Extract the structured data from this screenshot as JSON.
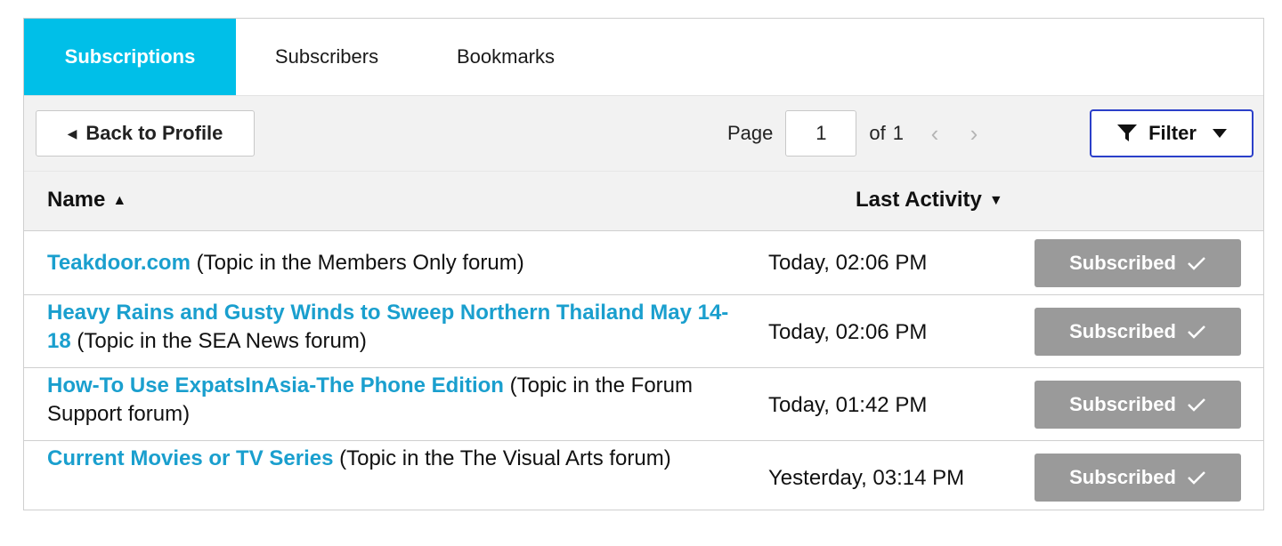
{
  "tabs": [
    {
      "label": "Subscriptions",
      "active": true
    },
    {
      "label": "Subscribers",
      "active": false
    },
    {
      "label": "Bookmarks",
      "active": false
    }
  ],
  "toolbar": {
    "back_label": "Back to Profile",
    "page_label": "Page",
    "page_value": "1",
    "of_label": "of",
    "total_pages": "1",
    "filter_label": "Filter"
  },
  "table": {
    "col_name": "Name",
    "col_activity": "Last Activity",
    "rows": [
      {
        "link": "Teakdoor.com",
        "context": " (Topic in the Members Only forum)",
        "time": "Today, 02:06 PM",
        "status": "Subscribed"
      },
      {
        "link": "Heavy Rains and Gusty Winds to Sweep Northern Thailand May 14-18",
        "context": " (Topic in the SEA News forum)",
        "time": "Today, 02:06 PM",
        "status": "Subscribed"
      },
      {
        "link": "How-To Use ExpatsInAsia-The Phone Edition",
        "context": " (Topic in the Forum Support forum)",
        "time": "Today, 01:42 PM",
        "status": "Subscribed"
      },
      {
        "link": "Current Movies or TV Series",
        "context": " (Topic in the The Visual Arts forum)",
        "time": "Yesterday, 03:14 PM",
        "status": "Subscribed"
      }
    ]
  },
  "colors": {
    "active_tab": "#00bfe8",
    "link": "#1a9fce",
    "subscribed_button": "#9a9a9a",
    "filter_border": "#2b3fc9"
  }
}
